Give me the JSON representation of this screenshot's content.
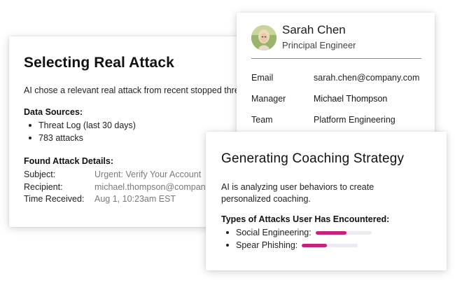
{
  "attack_card": {
    "title": "Selecting Real Attack",
    "description": "AI chose a relevant real attack from recent stopped threats",
    "data_sources_heading": "Data Sources:",
    "data_sources": [
      "Threat Log (last 30 days)",
      "783 attacks"
    ],
    "details_heading": "Found Attack Details:",
    "details": [
      {
        "label": "Subject:",
        "value": "Urgent: Verify Your Account"
      },
      {
        "label": "Recipient:",
        "value": "michael.thompson@company.com"
      },
      {
        "label": "Time Received:",
        "value": "Aug 1, 10:23am EST"
      }
    ]
  },
  "profile_card": {
    "name": "Sarah Chen",
    "role": "Principal Engineer",
    "fields": [
      {
        "label": "Email",
        "value": "sarah.chen@company.com"
      },
      {
        "label": "Manager",
        "value": "Michael Thompson"
      },
      {
        "label": "Team",
        "value": "Platform Engineering"
      }
    ]
  },
  "coaching_card": {
    "title": "Generating Coaching Strategy",
    "description": "AI is analyzing user behaviors to create personalized coaching.",
    "attack_types_heading": "Types of Attacks User Has Encountered:",
    "attack_types": [
      {
        "label": "Social Engineering:",
        "level": 0.55
      },
      {
        "label": "Spear Phishing:",
        "level": 0.45
      }
    ],
    "bar_color": "#c4227e",
    "track_color": "#ececf0"
  }
}
